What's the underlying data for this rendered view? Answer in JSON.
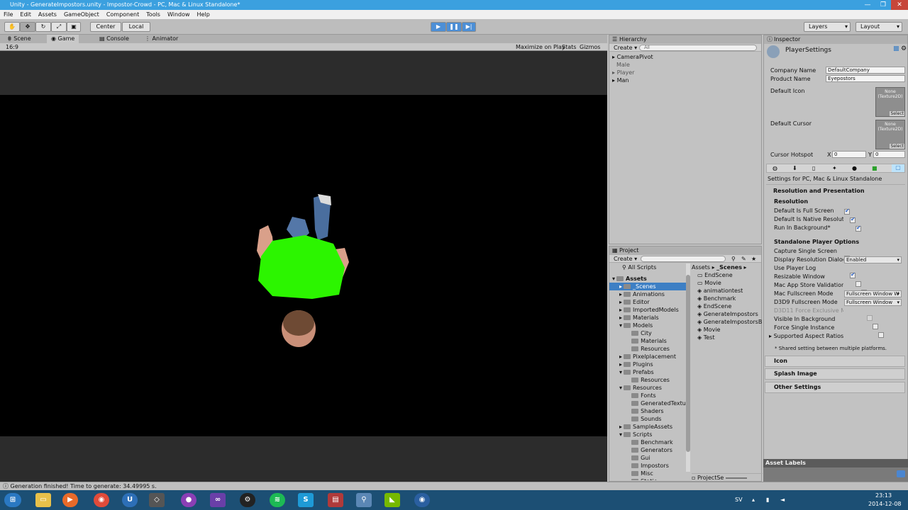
{
  "window": {
    "title": "Unity - GenerateImpostors.unity - Impostor-Crowd - PC, Mac & Linux Standalone*"
  },
  "menu": [
    "File",
    "Edit",
    "Assets",
    "GameObject",
    "Component",
    "Tools",
    "Window",
    "Help"
  ],
  "toolbar": {
    "pivot": "Center",
    "space": "Local",
    "layers": "Layers",
    "layout": "Layout"
  },
  "tabs": {
    "scene": "Scene",
    "game": "Game",
    "console": "Console",
    "animator": "Animator"
  },
  "gamebar": {
    "aspect": "16:9",
    "maximize": "Maximize on Play",
    "stats": "Stats",
    "gizmos": "Gizmos"
  },
  "hierarchy": {
    "title": "Hierarchy",
    "create": "Create",
    "search_placeholder": "All",
    "items": [
      "CameraPivot",
      "Male",
      "Player",
      "Man"
    ]
  },
  "project": {
    "title": "Project",
    "create": "Create",
    "all_scripts": "All Scripts",
    "tree": [
      {
        "label": "Assets",
        "indent": 0,
        "bold": true
      },
      {
        "label": "_Scenes",
        "indent": 1,
        "selected": true
      },
      {
        "label": "Animations",
        "indent": 1
      },
      {
        "label": "Editor",
        "indent": 1
      },
      {
        "label": "ImportedModels",
        "indent": 1
      },
      {
        "label": "Materials",
        "indent": 1
      },
      {
        "label": "Models",
        "indent": 1
      },
      {
        "label": "City",
        "indent": 2
      },
      {
        "label": "Materials",
        "indent": 2
      },
      {
        "label": "Resources",
        "indent": 2
      },
      {
        "label": "Pixelplacement",
        "indent": 1
      },
      {
        "label": "Plugins",
        "indent": 1
      },
      {
        "label": "Prefabs",
        "indent": 1
      },
      {
        "label": "Resources",
        "indent": 2
      },
      {
        "label": "Resources",
        "indent": 1
      },
      {
        "label": "Fonts",
        "indent": 2
      },
      {
        "label": "GeneratedTextures",
        "indent": 2
      },
      {
        "label": "Shaders",
        "indent": 2
      },
      {
        "label": "Sounds",
        "indent": 2
      },
      {
        "label": "SampleAssets",
        "indent": 1
      },
      {
        "label": "Scripts",
        "indent": 1
      },
      {
        "label": "Benchmark",
        "indent": 2
      },
      {
        "label": "Generators",
        "indent": 2
      },
      {
        "label": "Gui",
        "indent": 2
      },
      {
        "label": "Impostors",
        "indent": 2
      },
      {
        "label": "Misc",
        "indent": 2
      },
      {
        "label": "Static",
        "indent": 2
      }
    ],
    "breadcrumb_root": "Assets",
    "breadcrumb_current": "_Scenes",
    "files": [
      "EndScene",
      "Movie",
      "animationtest",
      "Benchmark",
      "EndScene",
      "GenerateImpostors",
      "GenerateImpostorsB",
      "Movie",
      "Test"
    ],
    "footer": "ProjectSe"
  },
  "inspector": {
    "title": "Inspector",
    "object": "PlayerSettings",
    "company_label": "Company Name",
    "company_value": "DefaultCompany",
    "product_label": "Product Name",
    "product_value": "Eyepostors",
    "icon_label": "Default Icon",
    "cursor_label": "Default Cursor",
    "none_tex": "None",
    "texture2d": "(Texture2D)",
    "select": "Select",
    "hotspot_label": "Cursor Hotspot",
    "hotspot_x_label": "X",
    "hotspot_x": "0",
    "hotspot_y_label": "Y",
    "hotspot_y": "0",
    "platform": "Settings for PC, Mac & Linux Standalone",
    "res_presentation": "Resolution and Presentation",
    "resolution": "Resolution",
    "checks1": [
      {
        "label": "Default Is Full Screen",
        "on": true
      },
      {
        "label": "Default Is Native Resolutio",
        "on": true
      },
      {
        "label": "Run In Background*",
        "on": true
      }
    ],
    "standalone": "Standalone Player Options",
    "rows2": [
      {
        "label": "Capture Single Screen",
        "type": "check",
        "on": false
      },
      {
        "label": "Display Resolution Dialog",
        "type": "select",
        "value": "Enabled"
      },
      {
        "label": "Use Player Log",
        "type": "check",
        "on": true
      },
      {
        "label": "Resizable Window",
        "type": "check",
        "on": false
      },
      {
        "label": "Mac App Store Validation",
        "type": "check",
        "on": false
      },
      {
        "label": "Mac Fullscreen Mode",
        "type": "select",
        "value": "Fullscreen Window W"
      },
      {
        "label": "D3D9 Fullscreen Mode",
        "type": "select",
        "value": "Fullscreen Window"
      },
      {
        "label": "D3D11 Force Exclusive Mo",
        "type": "check",
        "on": false,
        "disabled": true
      },
      {
        "label": "Visible In Background",
        "type": "check",
        "on": false
      },
      {
        "label": "Force Single Instance",
        "type": "check",
        "on": false
      }
    ],
    "aspect": "Supported Aspect Ratios",
    "shared_note": "* Shared setting between multiple platforms.",
    "icon_section": "Icon",
    "splash_section": "Splash Image",
    "other_section": "Other Settings",
    "asset_labels": "Asset Labels"
  },
  "status": {
    "message": "Generation finished! Time to generate: 34.49995 s."
  },
  "taskbar": {
    "lang": "SV",
    "time": "23:13",
    "date": "2014-12-08"
  },
  "colors": {
    "shirt": "#2cf500",
    "play_active": "#4d8fd6"
  }
}
